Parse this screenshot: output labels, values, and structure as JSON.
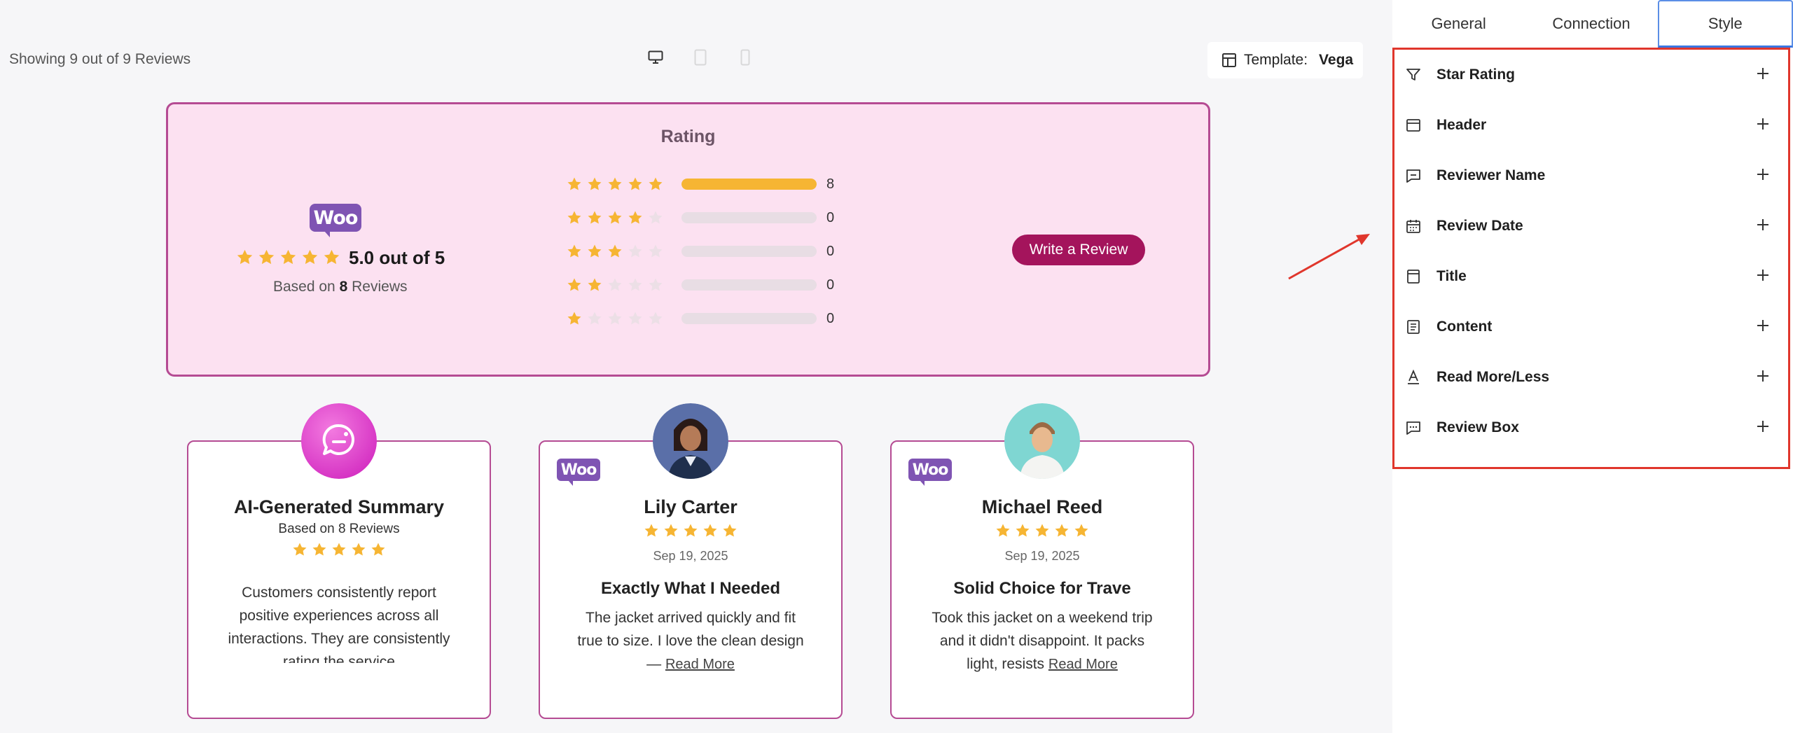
{
  "preview": {
    "showing_text": "Showing 9 out of 9 Reviews",
    "template_label": "Template:",
    "template_value": "Vega"
  },
  "summary": {
    "title": "Rating",
    "logo_text": "Woo",
    "score_text": "5.0 out of 5",
    "based_prefix": "Based on",
    "based_count": "8",
    "based_suffix": "Reviews",
    "average_rating": 5,
    "distribution": [
      {
        "stars": 5,
        "count": "8",
        "fraction": 1.0
      },
      {
        "stars": 4,
        "count": "0",
        "fraction": 0
      },
      {
        "stars": 3,
        "count": "0",
        "fraction": 0
      },
      {
        "stars": 2,
        "count": "0",
        "fraction": 0
      },
      {
        "stars": 1,
        "count": "0",
        "fraction": 0
      }
    ],
    "write_button": "Write a Review"
  },
  "cards": {
    "ai": {
      "name": "AI-Generated Summary",
      "sub": "Based on 8 Reviews",
      "rating": 5,
      "body": "Customers consistently report positive experiences across all interactions. They are consistently rating the service"
    },
    "lily": {
      "logo_text": "Woo",
      "name": "Lily Carter",
      "rating": 5,
      "date": "Sep 19, 2025",
      "title": "Exactly What I Needed",
      "body": "The jacket arrived quickly and fit true to size. I love the clean design —",
      "read_more": "Read More"
    },
    "michael": {
      "logo_text": "Woo",
      "name": "Michael Reed",
      "rating": 5,
      "date": "Sep 19, 2025",
      "title": "Solid Choice for Trave",
      "body": "Took this jacket on a weekend trip and it didn't disappoint. It packs light, resists",
      "read_more": "Read More"
    }
  },
  "panel": {
    "tabs": [
      {
        "label": "General"
      },
      {
        "label": "Connection"
      },
      {
        "label": "Style",
        "active": true
      }
    ],
    "sections": [
      {
        "label": "Star Rating",
        "icon": "filter-icon"
      },
      {
        "label": "Header",
        "icon": "header-icon"
      },
      {
        "label": "Reviewer Name",
        "icon": "reviewer-name-icon"
      },
      {
        "label": "Review Date",
        "icon": "calendar-icon"
      },
      {
        "label": "Title",
        "icon": "title-icon"
      },
      {
        "label": "Content",
        "icon": "content-icon"
      },
      {
        "label": "Read More/Less",
        "icon": "text-a-icon"
      },
      {
        "label": "Review Box",
        "icon": "review-box-icon"
      }
    ]
  },
  "colors": {
    "accent_pink_border": "#b54b93",
    "rating_box_bg": "#fce1f1",
    "write_button_bg": "#a4145c",
    "star_color": "#f6b533",
    "woo_purple": "#7f54b3",
    "highlight_red": "#e0362c",
    "active_tab_blue": "#3a76e0"
  }
}
